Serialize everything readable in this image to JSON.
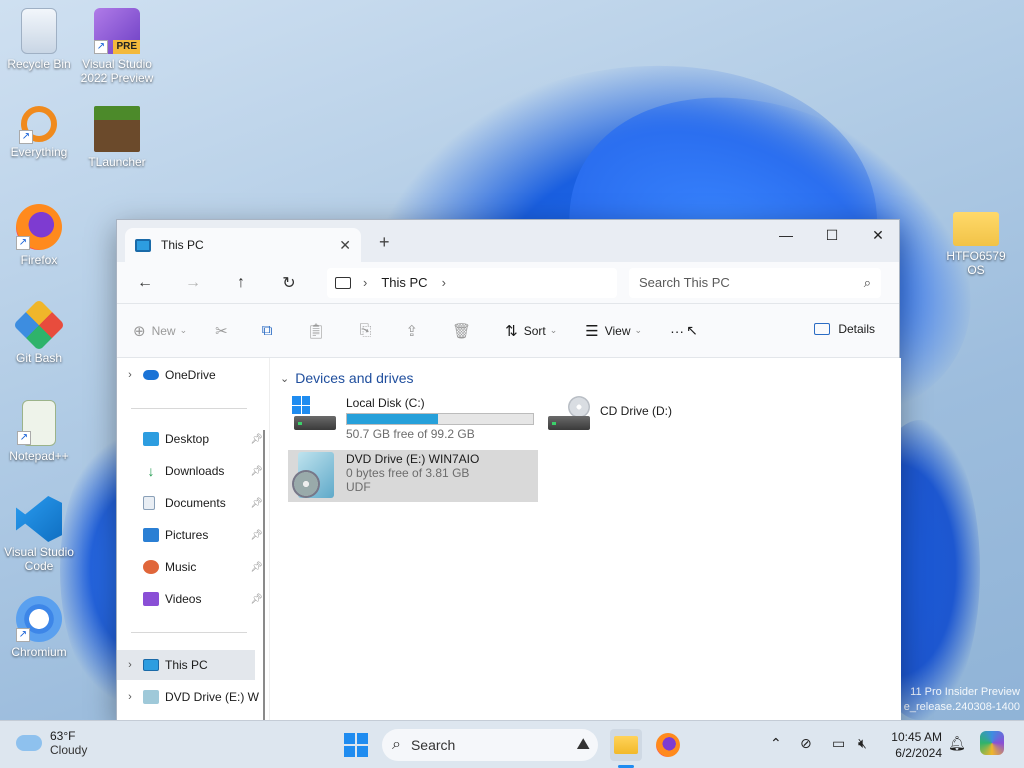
{
  "desktop": {
    "icons": [
      {
        "label": "Recycle Bin",
        "icon": "recycle-bin-icon"
      },
      {
        "label": "Visual Studio 2022 Preview",
        "icon": "visual-studio-icon",
        "badge": "PRE"
      },
      {
        "label": "Everything",
        "icon": "everything-search-icon"
      },
      {
        "label": "TLauncher",
        "icon": "tlauncher-icon"
      },
      {
        "label": "Firefox",
        "icon": "firefox-icon"
      },
      {
        "label": "Git Bash",
        "icon": "git-bash-icon"
      },
      {
        "label": "Notepad++",
        "icon": "notepad-plus-plus-icon"
      },
      {
        "label": "Visual Studio Code",
        "icon": "vscode-icon"
      },
      {
        "label": "Chromium",
        "icon": "chromium-icon"
      },
      {
        "label": "HTFO6579 OS",
        "icon": "folder-icon"
      }
    ],
    "watermark": {
      "line1": "11 Pro Insider Preview",
      "line2": "e_release.240308-1400"
    }
  },
  "explorer": {
    "tab_title": "This PC",
    "breadcrumb": {
      "item": "This PC"
    },
    "search_placeholder": "Search This PC",
    "toolbar": {
      "new_label": "New",
      "sort_label": "Sort",
      "view_label": "View",
      "more_label": "···",
      "details_label": "Details"
    },
    "nav": {
      "onedrive": "OneDrive",
      "quick": [
        {
          "label": "Desktop",
          "color": "#2d9de0"
        },
        {
          "label": "Downloads",
          "color": "#1f9a4e"
        },
        {
          "label": "Documents",
          "color": "#8aa0b8"
        },
        {
          "label": "Pictures",
          "color": "#2a7fd4"
        },
        {
          "label": "Music",
          "color": "#e0663a"
        },
        {
          "label": "Videos",
          "color": "#8a4fd6"
        }
      ],
      "this_pc": "This PC",
      "dvd": "DVD Drive (E:) W"
    },
    "group_header": "Devices and drives",
    "drives": [
      {
        "name": "Local Disk (C:)",
        "sub": "50.7 GB free of 99.2 GB",
        "used_fraction": 0.49
      },
      {
        "name": "CD Drive (D:)"
      },
      {
        "name": "DVD Drive (E:) WIN7AIO",
        "sub": "0 bytes free of 3.81 GB",
        "fs": "UDF"
      }
    ]
  },
  "taskbar": {
    "weather_temp": "63°F",
    "weather_text": "Cloudy",
    "search_label": "Search",
    "time": "10:45 AM",
    "date": "6/2/2024"
  },
  "colors": {
    "accent": "#1f8cf0",
    "progress": "#26a0da",
    "selected": "#d9d9d9"
  }
}
